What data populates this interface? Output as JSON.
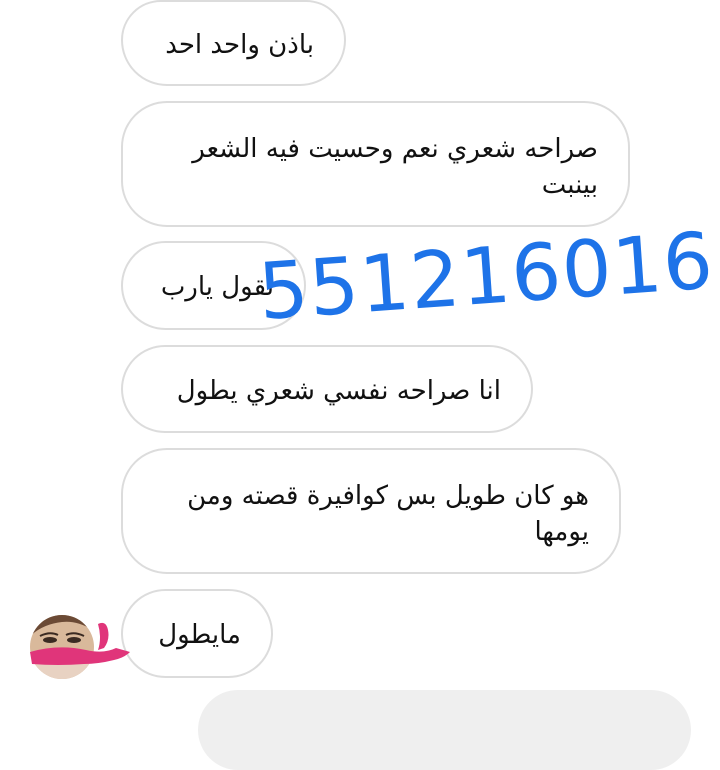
{
  "messages": [
    {
      "text": "باذن واحد احد"
    },
    {
      "text": "صراحه شعري نعم وحسيت فيه الشعر بينبت"
    },
    {
      "text": "نقول يارب"
    },
    {
      "text": "انا صراحه نفسي شعري يطول"
    },
    {
      "text": "هو كان طويل بس كوافيرة قصته ومن يومها"
    },
    {
      "text": "مايطول"
    }
  ],
  "watermark": "551216016",
  "colors": {
    "watermark": "#1e73e8",
    "bubble_border": "#dcdcdc",
    "outgoing_bubble": "#efefef",
    "censor_mark": "#e0357a"
  }
}
